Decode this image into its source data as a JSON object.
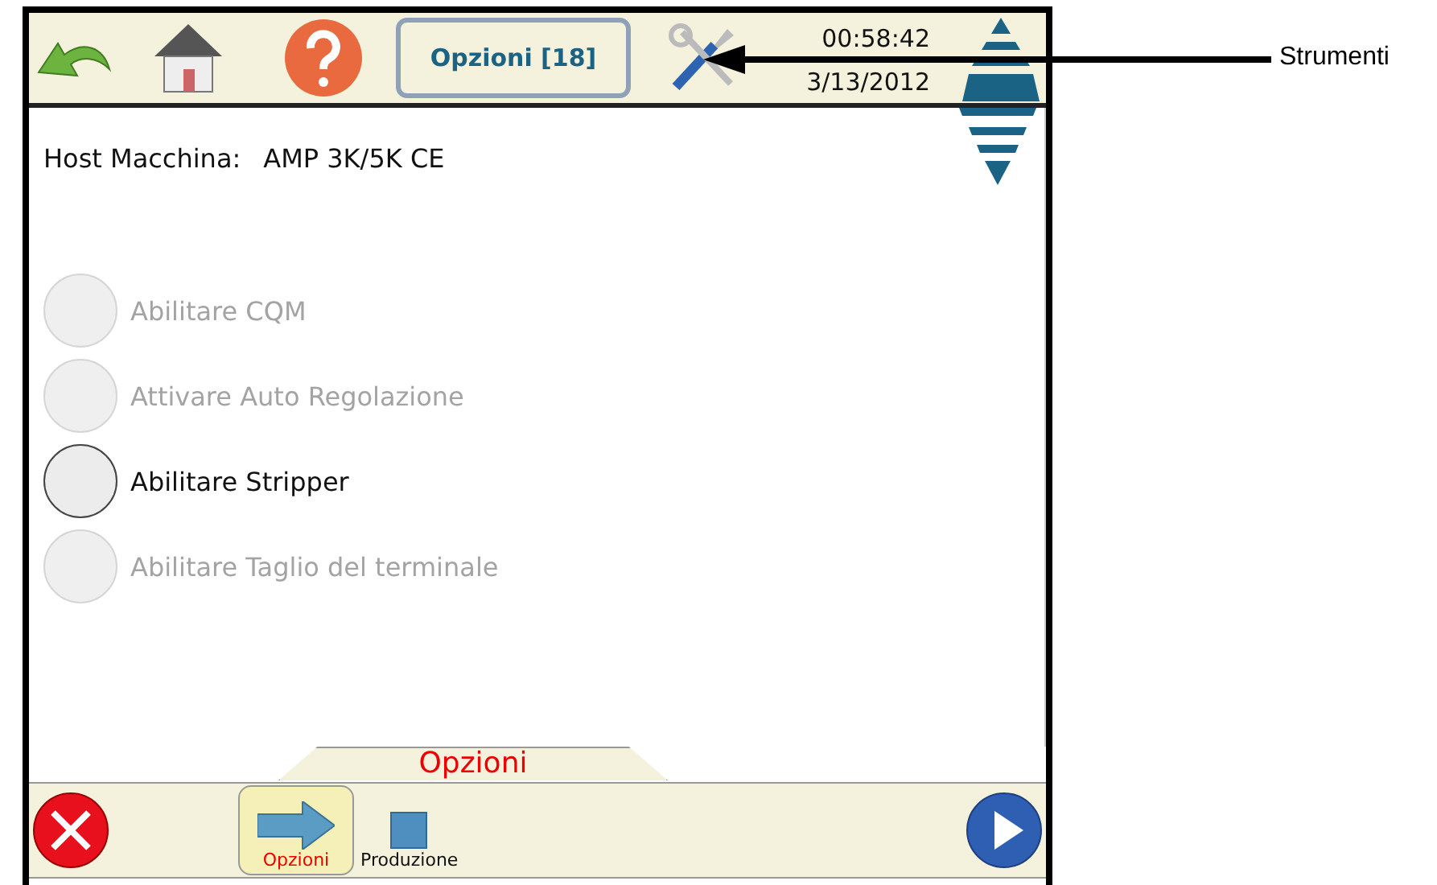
{
  "toolbar": {
    "title_button": "Opzioni [18]",
    "time": "00:58:42",
    "date": "3/13/2012"
  },
  "host": {
    "label": "Host Macchina:",
    "value": "AMP 3K/5K CE"
  },
  "options": [
    {
      "label": "Abilitare CQM",
      "disabled": true,
      "selected": false
    },
    {
      "label": "Attivare Auto Regolazione",
      "disabled": true,
      "selected": false
    },
    {
      "label": "Abilitare Stripper",
      "disabled": false,
      "selected": false
    },
    {
      "label": "Abilitare Taglio del terminale",
      "disabled": true,
      "selected": false
    }
  ],
  "tab_title": "Opzioni",
  "nav": [
    {
      "label": "Opzioni",
      "kind": "arrow",
      "selected": true
    },
    {
      "label": "Produzione",
      "kind": "square",
      "selected": false
    }
  ],
  "callout": {
    "label": "Strumenti"
  }
}
